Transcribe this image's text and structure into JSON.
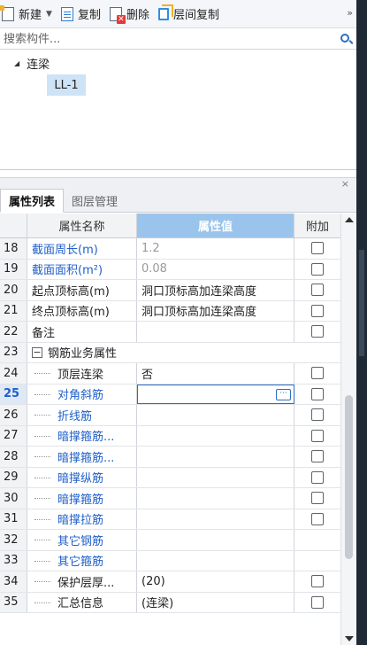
{
  "toolbar": {
    "new_label": "新建",
    "copy_label": "复制",
    "delete_label": "删除",
    "floor_copy_label": "层间复制",
    "more_label": "»"
  },
  "search": {
    "placeholder": "搜索构件..."
  },
  "tree": {
    "group_label": "连梁",
    "child_label": "LL-1"
  },
  "panel": {
    "close_label": "×"
  },
  "tabs": [
    {
      "label": "属性列表",
      "active": true
    },
    {
      "label": "图层管理",
      "active": false
    }
  ],
  "grid": {
    "headers": {
      "name": "属性名称",
      "value": "属性值",
      "add": "附加"
    },
    "rows": [
      {
        "idx": "18",
        "name": "截面周长(m)",
        "value": "1.2"
      },
      {
        "idx": "19",
        "name": "截面面积(m²)",
        "value": "0.08"
      },
      {
        "idx": "20",
        "name": "起点顶标高(m)",
        "value": "洞口顶标高加连梁高度"
      },
      {
        "idx": "21",
        "name": "终点顶标高(m)",
        "value": "洞口顶标高加连梁高度"
      },
      {
        "idx": "22",
        "name": "备注",
        "value": ""
      },
      {
        "idx": "23",
        "name": "钢筋业务属性",
        "value": ""
      },
      {
        "idx": "24",
        "name": "顶层连梁",
        "value": "否"
      },
      {
        "idx": "25",
        "name": "对角斜筋",
        "value": ""
      },
      {
        "idx": "26",
        "name": "折线筋",
        "value": ""
      },
      {
        "idx": "27",
        "name": "暗撑箍筋...",
        "value": ""
      },
      {
        "idx": "28",
        "name": "暗撑箍筋...",
        "value": ""
      },
      {
        "idx": "29",
        "name": "暗撑纵筋",
        "value": ""
      },
      {
        "idx": "30",
        "name": "暗撑箍筋",
        "value": ""
      },
      {
        "idx": "31",
        "name": "暗撑拉筋",
        "value": ""
      },
      {
        "idx": "32",
        "name": "其它钢筋",
        "value": ""
      },
      {
        "idx": "33",
        "name": "其它箍筋",
        "value": ""
      },
      {
        "idx": "34",
        "name": "保护层厚...",
        "value": "(20)"
      },
      {
        "idx": "35",
        "name": "汇总信息",
        "value": "(连梁)"
      }
    ],
    "group_toggle": "−",
    "edit_button": "···"
  },
  "colors": {
    "accent": "#9bc4ec",
    "link_blue": "#1f5fc9",
    "selected_tree": "#cfe3f6",
    "background_dark": "#1f2a36"
  }
}
